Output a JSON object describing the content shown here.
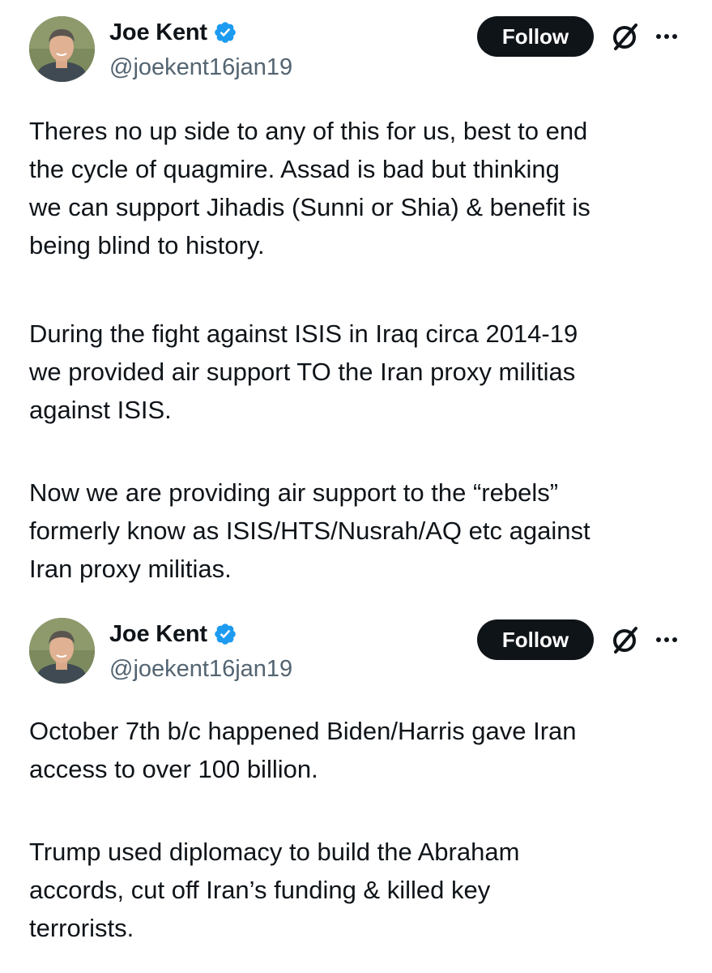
{
  "tweets": [
    {
      "author": {
        "display_name": "Joe Kent",
        "handle": "@joekent16jan19",
        "verified": true
      },
      "follow_label": "Follow",
      "body": [
        "Theres no up side to any of this for us, best to end\nthe cycle of quagmire. Assad is bad but thinking\nwe can support Jihadis (Sunni or Shia) & benefit is\nbeing blind to history.",
        "During the fight against ISIS in Iraq circa 2014-19\nwe provided air support TO the Iran proxy militias\nagainst ISIS.",
        "Now we are providing air support to the “rebels”\nformerly know as ISIS/HTS/Nusrah/AQ etc against\nIran proxy militias."
      ]
    },
    {
      "author": {
        "display_name": "Joe Kent",
        "handle": "@joekent16jan19",
        "verified": true
      },
      "follow_label": "Follow",
      "body": [
        "October 7th b/c happened Biden/Harris gave Iran\naccess to over 100 billion.",
        "Trump used diplomacy to build the Abraham\naccords, cut off Iran’s funding & killed key\nterrorists."
      ]
    }
  ],
  "icons": {
    "verified": "verified-badge-icon",
    "grok": "grok-icon",
    "more": "more-options-icon"
  },
  "colors": {
    "text": "#0f1419",
    "secondary": "#536471",
    "verified": "#1d9bf0",
    "follow_bg": "#0f1419",
    "follow_text": "#ffffff"
  }
}
